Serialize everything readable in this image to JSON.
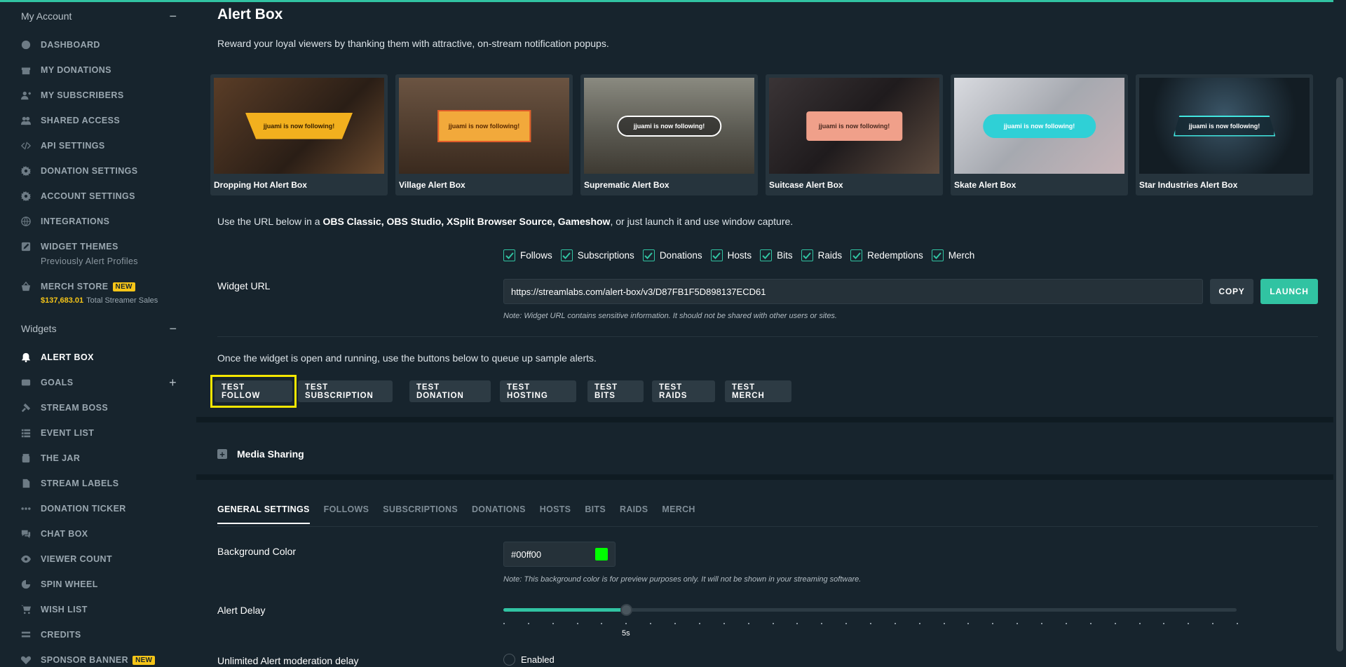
{
  "sidebar": {
    "account_heading": "My Account",
    "account_toggle": "−",
    "items": [
      {
        "label": "DASHBOARD",
        "icon": "dashboard-icon"
      },
      {
        "label": "MY DONATIONS",
        "icon": "donations-icon"
      },
      {
        "label": "MY SUBSCRIBERS",
        "icon": "subscribers-icon"
      },
      {
        "label": "SHARED ACCESS",
        "icon": "shared-access-icon"
      },
      {
        "label": "API SETTINGS",
        "icon": "code-icon"
      },
      {
        "label": "DONATION SETTINGS",
        "icon": "gear-icon"
      },
      {
        "label": "ACCOUNT SETTINGS",
        "icon": "gear-icon"
      },
      {
        "label": "INTEGRATIONS",
        "icon": "globe-icon"
      },
      {
        "label": "WIDGET THEMES",
        "icon": "edit-icon",
        "sub": "Previously Alert Profiles"
      },
      {
        "label": "MERCH STORE",
        "icon": "basket-icon",
        "badge": "NEW",
        "sales_amount": "$137,683.01",
        "sales_label": "Total Streamer Sales"
      }
    ],
    "widgets_heading": "Widgets",
    "widgets_toggle": "−",
    "widgets": [
      {
        "label": "ALERT BOX",
        "icon": "bell-icon",
        "active": true
      },
      {
        "label": "GOALS",
        "icon": "goals-icon",
        "plus": "+"
      },
      {
        "label": "STREAM BOSS",
        "icon": "hammer-icon"
      },
      {
        "label": "EVENT LIST",
        "icon": "list-icon"
      },
      {
        "label": "THE JAR",
        "icon": "jar-icon"
      },
      {
        "label": "STREAM LABELS",
        "icon": "file-icon"
      },
      {
        "label": "DONATION TICKER",
        "icon": "ellipsis-icon"
      },
      {
        "label": "CHAT BOX",
        "icon": "chat-icon"
      },
      {
        "label": "VIEWER COUNT",
        "icon": "eye-icon"
      },
      {
        "label": "SPIN WHEEL",
        "icon": "wheel-icon"
      },
      {
        "label": "WISH LIST",
        "icon": "cart-icon"
      },
      {
        "label": "CREDITS",
        "icon": "credits-icon"
      },
      {
        "label": "SPONSOR BANNER",
        "icon": "heart-icon",
        "badge": "NEW"
      }
    ]
  },
  "main": {
    "title": "Alert Box",
    "intro": "Reward your loyal viewers by thanking them with attractive, on-stream notification popups.",
    "themes": [
      {
        "name": "Dropping Hot Alert Box",
        "banner": "jjuami is now following!",
        "bg": "#3a2a1e",
        "accent": "#f2b01e"
      },
      {
        "name": "Village Alert Box",
        "banner": "jjuami is now following!",
        "bg": "#4a3424",
        "accent": "#f2a93b"
      },
      {
        "name": "Suprematic Alert Box",
        "banner": "jjuami is now following!",
        "bg": "#6b6a62",
        "accent": "#ffffff"
      },
      {
        "name": "Suitcase Alert Box",
        "banner": "jjuami is now following!",
        "bg": "#2e2a2c",
        "accent": "#f0a08a"
      },
      {
        "name": "Skate Alert Box",
        "banner": "jjuami is now following!",
        "bg": "#b9bcc4",
        "accent": "#2fd0d6"
      },
      {
        "name": "Star Industries Alert Box",
        "banner": "jjuami is now following!",
        "bg": "#1d2a33",
        "accent": "#42e6e0"
      }
    ],
    "url_info_prefix": "Use the URL below in a ",
    "url_info_sources": "OBS Classic, OBS Studio, XSplit Browser Source, Gameshow",
    "url_info_suffix": ", or just launch it and use window capture.",
    "checkboxes": [
      {
        "label": "Follows",
        "checked": true
      },
      {
        "label": "Subscriptions",
        "checked": true
      },
      {
        "label": "Donations",
        "checked": true
      },
      {
        "label": "Hosts",
        "checked": true
      },
      {
        "label": "Bits",
        "checked": true
      },
      {
        "label": "Raids",
        "checked": true
      },
      {
        "label": "Redemptions",
        "checked": true
      },
      {
        "label": "Merch",
        "checked": true
      }
    ],
    "widget_url_label": "Widget URL",
    "widget_url": "https://streamlabs.com/alert-box/v3/D87FB1F5D898137ECD61",
    "copy_label": "COPY",
    "launch_label": "LAUNCH",
    "url_note": "Note: Widget URL contains sensitive information. It should not be shared with other users or sites.",
    "queue_text": "Once the widget is open and running, use the buttons below to queue up sample alerts.",
    "test_buttons": [
      "TEST FOLLOW",
      "TEST SUBSCRIPTION",
      "TEST DONATION",
      "TEST HOSTING",
      "TEST BITS",
      "TEST RAIDS",
      "TEST MERCH"
    ],
    "media_sharing_label": "Media Sharing",
    "tabs": [
      "GENERAL SETTINGS",
      "FOLLOWS",
      "SUBSCRIPTIONS",
      "DONATIONS",
      "HOSTS",
      "BITS",
      "RAIDS",
      "MERCH"
    ],
    "active_tab": "GENERAL SETTINGS",
    "background_color_label": "Background Color",
    "background_color_value": "#00ff00",
    "background_note": "Note: This background color is for preview purposes only. It will not be shown in your streaming software.",
    "alert_delay_label": "Alert Delay",
    "alert_delay_value": "5s",
    "alert_delay_fraction": 0.167,
    "moderation_label": "Unlimited Alert moderation delay",
    "moderation_option": "Enabled"
  },
  "colors": {
    "accent": "#31c3a2",
    "highlight": "#f5e700",
    "badge": "#f5c518"
  }
}
